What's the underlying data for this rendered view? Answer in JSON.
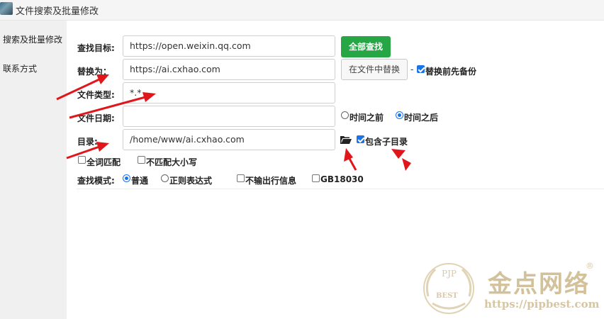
{
  "window": {
    "title": "文件搜索及批量修改"
  },
  "sidebar": {
    "items": [
      {
        "label": "搜索及批量修改"
      },
      {
        "label": "联系方式"
      }
    ]
  },
  "form": {
    "search_target": {
      "label": "查找目标:",
      "value": "https://open.weixin.qq.com"
    },
    "replace_with": {
      "label": "替换为：",
      "value": "https://ai.cxhao.com"
    },
    "file_type": {
      "label": "文件类型:",
      "value": "*.*"
    },
    "file_date": {
      "label": "文件日期:",
      "value": ""
    },
    "directory": {
      "label": "目录:",
      "value": "/home/www/ai.cxhao.com"
    },
    "search_all_button": "全部查找",
    "replace_in_files_button": "在文件中替换",
    "separator": "-",
    "backup_before_replace": {
      "label": "替换前先备份",
      "checked": true
    },
    "date_before": {
      "label": "时间之前",
      "selected": false
    },
    "date_after": {
      "label": "时间之后",
      "selected": true
    },
    "include_subdirs": {
      "label": "包含子目录",
      "checked": true
    },
    "whole_word": {
      "label": "全词匹配",
      "checked": false
    },
    "ignore_case": {
      "label": "不匹配大小写",
      "checked": false
    },
    "search_mode": {
      "label": "查找模式:",
      "normal": {
        "label": "普通",
        "selected": true
      },
      "regex": {
        "label": "正则表达式",
        "selected": false
      },
      "no_line_output": {
        "label": "不输出行信息",
        "checked": false
      },
      "gb18030": {
        "label": "GB18030",
        "checked": false
      }
    }
  },
  "watermark": {
    "badge_top": "PJP",
    "badge_bottom": "BEST",
    "brand": "金点网络",
    "url": "https://pipbest.com",
    "registered": "®"
  },
  "colors": {
    "primary_button": "#26a644",
    "accent": "#1a73e8",
    "annotation_arrow": "#e0161b"
  }
}
